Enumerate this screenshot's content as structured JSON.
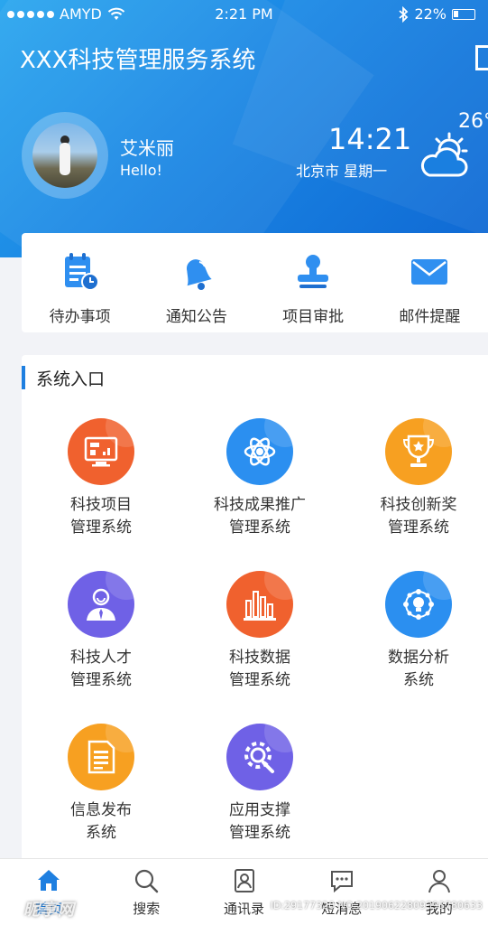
{
  "status": {
    "carrier": "AMYD",
    "time": "2:21 PM",
    "battery": "22%"
  },
  "header": {
    "title": "XXX科技管理服务系统",
    "user_name": "艾米丽",
    "greeting": "Hello!",
    "clock": "14:21",
    "location": "北京市  星期一",
    "temperature": "26°"
  },
  "quick": [
    {
      "label": "待办事项",
      "icon": "todo-icon"
    },
    {
      "label": "通知公告",
      "icon": "bell-icon"
    },
    {
      "label": "项目审批",
      "icon": "stamp-icon"
    },
    {
      "label": "邮件提醒",
      "icon": "mail-icon"
    }
  ],
  "section": {
    "title": "系统入口"
  },
  "systems": [
    {
      "line1": "科技项目",
      "line2": "管理系统",
      "color": "#f0612e",
      "icon": "monitor-icon"
    },
    {
      "line1": "科技成果推广",
      "line2": "管理系统",
      "color": "#2b8ff0",
      "icon": "atom-icon"
    },
    {
      "line1": "科技创新奖",
      "line2": "管理系统",
      "color": "#f7a021",
      "icon": "trophy-icon"
    },
    {
      "line1": "科技人才",
      "line2": "管理系统",
      "color": "#6f61e6",
      "icon": "person-icon"
    },
    {
      "line1": "科技数据",
      "line2": "管理系统",
      "color": "#f0612e",
      "icon": "bar-chart-icon"
    },
    {
      "line1": "数据分析",
      "line2": "系统",
      "color": "#2b8ff0",
      "icon": "network-icon"
    },
    {
      "line1": "信息发布",
      "line2": "系统",
      "color": "#f7a021",
      "icon": "document-icon"
    },
    {
      "line1": "应用支撑",
      "line2": "管理系统",
      "color": "#6f61e6",
      "icon": "settings-icon"
    }
  ],
  "tabs": [
    {
      "label": "首页",
      "icon": "home-icon"
    },
    {
      "label": "搜索",
      "icon": "search-icon"
    },
    {
      "label": "通讯录",
      "icon": "contacts-icon"
    },
    {
      "label": "短消息",
      "icon": "message-icon"
    },
    {
      "label": "我的",
      "icon": "profile-icon"
    }
  ],
  "watermark": {
    "brand": "昵享网",
    "id": "ID:29177320 NO:20190622809393780633"
  }
}
